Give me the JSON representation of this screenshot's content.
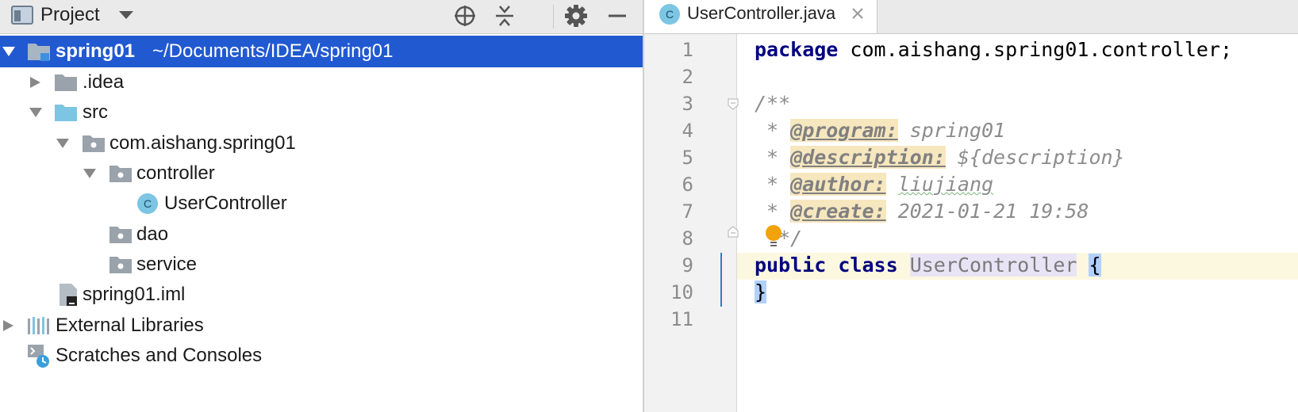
{
  "project_panel": {
    "title": "Project",
    "tree": {
      "root_name": "spring01",
      "root_path": "~/Documents/IDEA/spring01",
      "idea": ".idea",
      "src": "src",
      "package": "com.aishang.spring01",
      "controller": "controller",
      "user_controller": "UserController",
      "dao": "dao",
      "service": "service",
      "iml": "spring01.iml",
      "external_libraries": "External Libraries",
      "scratches": "Scratches and Consoles"
    }
  },
  "editor": {
    "tab_label": "UserController.java",
    "tab_icon_letter": "C",
    "line_numbers": [
      "1",
      "2",
      "3",
      "4",
      "5",
      "6",
      "7",
      "8",
      "9",
      "10",
      "11"
    ],
    "code": {
      "l1_kw": "package",
      "l1_rest": " com.aishang.spring01.controller;",
      "l3": "/**",
      "star": " * ",
      "l4_tag": "@program:",
      "l4_val": " spring01",
      "l5_tag": "@description:",
      "l5_val": " ${description}",
      "l6_tag": "@author:",
      "l6_val": "liujiang",
      "l7_tag": "@create:",
      "l7_val": " 2021-01-21 19:58",
      "l8": "*/",
      "l9_kw1": "public",
      "l9_kw2": "class",
      "l9_cls": "UserController",
      "l9_brace": "{",
      "l10": "}"
    }
  },
  "colors": {
    "selection": "#2159d1",
    "folder": "#9aa3ab",
    "source_folder": "#7cc5e3",
    "class_icon": "#7cc5e3",
    "keyword": "#00007f",
    "comment": "#8c8c8c"
  },
  "icons": [
    "project-view-icon",
    "locate-icon",
    "collapse-all-icon",
    "gear-icon",
    "minimize-icon",
    "folder-icon",
    "class-icon",
    "library-icon",
    "scratches-icon",
    "close-icon",
    "bulb-icon"
  ]
}
